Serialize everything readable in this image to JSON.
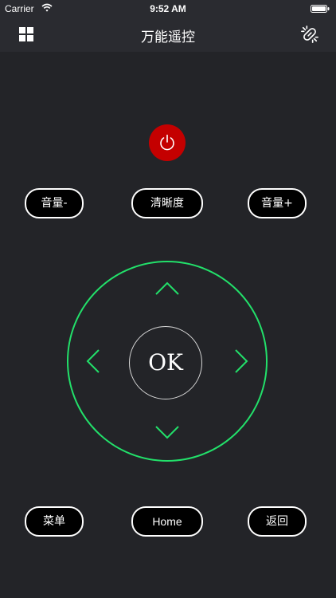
{
  "status_bar": {
    "carrier": "Carrier",
    "time": "9:52 AM",
    "wifi_icon": "wifi-icon",
    "battery_icon": "battery-icon"
  },
  "nav": {
    "title": "万能遥控",
    "left_icon": "grid-icon",
    "right_icon": "link-icon"
  },
  "power": {
    "icon": "power-icon",
    "color": "#c40000"
  },
  "top_buttons": {
    "volume_down": "音量-",
    "clarity": "清晰度",
    "volume_up": "音量+"
  },
  "dpad": {
    "ok_label": "OK",
    "ring_color": "#22e06a",
    "up_icon": "chevron-up-icon",
    "down_icon": "chevron-down-icon",
    "left_icon": "chevron-left-icon",
    "right_icon": "chevron-right-icon"
  },
  "bottom_buttons": {
    "menu": "菜单",
    "home": "Home",
    "back": "返回"
  },
  "colors": {
    "background": "#232428",
    "bar": "#2a2b30",
    "accent": "#22e06a",
    "power": "#c40000"
  }
}
